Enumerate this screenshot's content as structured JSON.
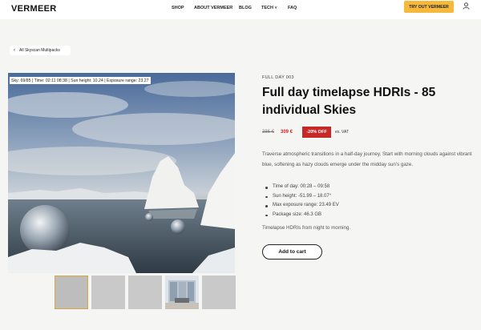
{
  "header": {
    "logo": "VERMEER",
    "nav": {
      "shop": "SHOP",
      "about": "ABOUT VERMEER",
      "blog": "BLOG",
      "tech": "TECH ˅",
      "faq": "FAQ"
    },
    "cta": "TRY OUT VERMEER",
    "cta_color": "#f6b93b"
  },
  "breadcrumb": {
    "back_label": "All Skyscan Multipacks"
  },
  "image_info": {
    "text": "Sky: 69/85  |  Time: 02:11 08:38  |  Sun height: 10.24  |  Exposure range: 23.27"
  },
  "product": {
    "subtitle": "FULL DAY 003",
    "title": "Full day timelapse HDRIs - 85 individual Skies",
    "old_price": "386 €",
    "new_price": "309 €",
    "discount": "-20% OFF",
    "vat": "ex. VAT",
    "description": "Traverse atmospheric transitions in a half-day journey. Start with morning clouds against vibrant blue, softening as hazy clouds emerge under the midday sun’s gaze.",
    "specs": [
      "Time of day: 00:28 – 09:58",
      "Sun height: -51.99 – 18.07°",
      "Max exposure range: 23.49 EV",
      "Package size: 46.3 GB"
    ],
    "tagline": "Timelapse HDRIs from night to morning.",
    "add_to_cart": "Add to cart",
    "accent_color": "#c62828"
  },
  "thumbnails": {
    "count": 5,
    "active_index": 0,
    "active_border_color": "#d8a642"
  }
}
